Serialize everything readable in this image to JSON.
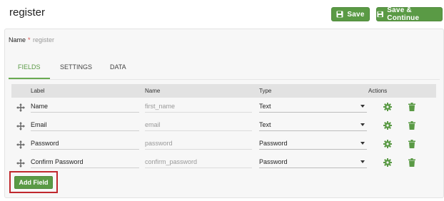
{
  "header": {
    "title": "register",
    "save_label": "Save",
    "save_continue_label": "Save & Continue",
    "accent": "#5a9a45"
  },
  "form": {
    "name_label": "Name",
    "required_mark": "*",
    "name_value": "register"
  },
  "tabs": [
    {
      "label": "FIELDS",
      "active": true
    },
    {
      "label": "SETTINGS",
      "active": false
    },
    {
      "label": "DATA",
      "active": false
    }
  ],
  "table": {
    "columns": [
      "Label",
      "Name",
      "Type",
      "Actions"
    ],
    "rows": [
      {
        "label": "Name",
        "name": "first_name",
        "type": "Text"
      },
      {
        "label": "Email",
        "name": "email",
        "type": "Text"
      },
      {
        "label": "Password",
        "name": "password",
        "type": "Password"
      },
      {
        "label": "Confirm Password",
        "name": "confirm_password",
        "type": "Password"
      }
    ]
  },
  "actions": {
    "add_field_label": "Add Field",
    "highlight_color": "#c0282d"
  },
  "icons": {
    "save": "floppy-disk-icon",
    "drag": "move-arrows-icon",
    "settings": "gear-icon",
    "delete": "trash-icon"
  }
}
